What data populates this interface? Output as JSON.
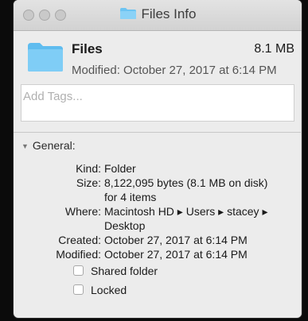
{
  "window": {
    "title": "Files Info"
  },
  "header": {
    "name": "Files",
    "size": "8.1 MB",
    "modified": "Modified: October 27, 2017 at 6:14 PM"
  },
  "tags": {
    "placeholder": "Add Tags..."
  },
  "general": {
    "section_label": "General:",
    "rows": [
      {
        "label": "Kind:",
        "value": "Folder"
      },
      {
        "label": "Size:",
        "value": "8,122,095 bytes (8.1 MB on disk)"
      },
      {
        "label": "",
        "value": "for 4 items"
      },
      {
        "label": "Where:",
        "value": "Macintosh HD ▸ Users ▸ stacey ▸"
      },
      {
        "label": "",
        "value": "Desktop"
      },
      {
        "label": "Created:",
        "value": "October 27, 2017 at 6:14 PM"
      },
      {
        "label": "Modified:",
        "value": "October 27, 2017 at 6:14 PM"
      }
    ],
    "shared_folder_label": "Shared folder",
    "locked_label": "Locked"
  },
  "icons": {
    "title_icon": "folder-icon",
    "header_icon": "folder-icon",
    "disclosure": "disclosure-triangle-icon"
  },
  "colors": {
    "folder": "#6cc4f2",
    "window_bg": "#ececec"
  }
}
